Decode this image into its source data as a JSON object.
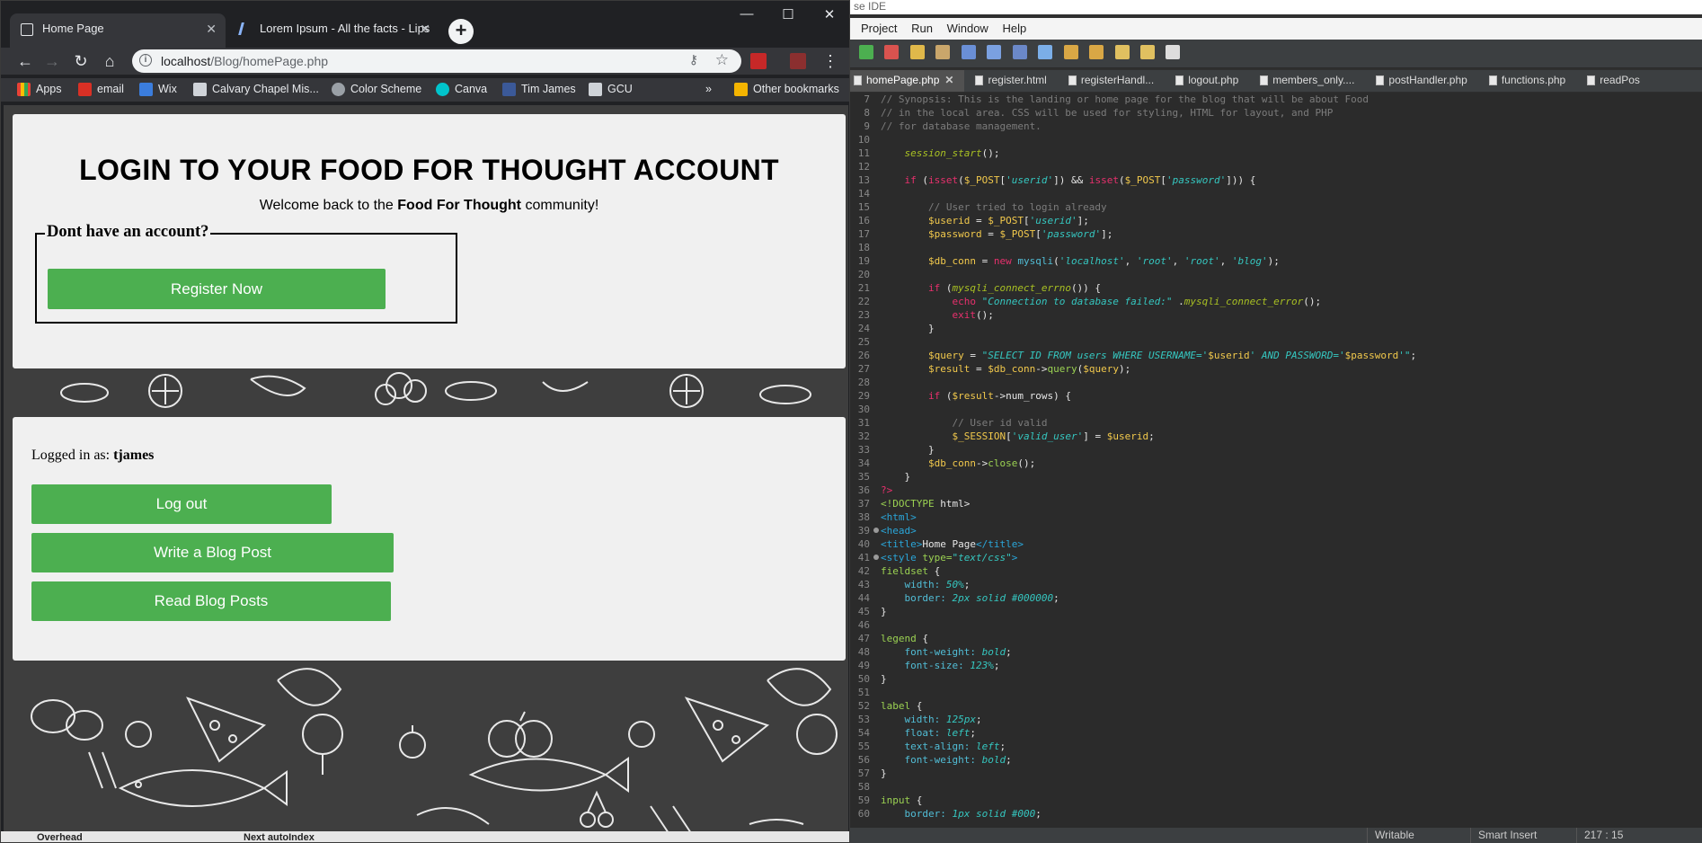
{
  "ide": {
    "title_fragment": "se IDE",
    "menu": [
      "Project",
      "Run",
      "Window",
      "Help"
    ],
    "tabs": [
      {
        "label": "homePage.php",
        "active": true
      },
      {
        "label": "register.html",
        "active": false
      },
      {
        "label": "registerHandl...",
        "active": false
      },
      {
        "label": "logout.php",
        "active": false
      },
      {
        "label": "members_only....",
        "active": false
      },
      {
        "label": "postHandler.php",
        "active": false
      },
      {
        "label": "functions.php",
        "active": false
      },
      {
        "label": "readPos",
        "active": false
      }
    ],
    "code": [
      {
        "n": "7",
        "segs": [
          [
            "c-comment",
            "// Synopsis: This is the landing or home page for the blog that will be about Food"
          ]
        ]
      },
      {
        "n": "8",
        "segs": [
          [
            "c-comment",
            "// in the local area. CSS will be used for styling, HTML for layout, and PHP"
          ]
        ]
      },
      {
        "n": "9",
        "segs": [
          [
            "c-comment",
            "// for database management."
          ]
        ]
      },
      {
        "n": "10",
        "segs": []
      },
      {
        "n": "11",
        "segs": [
          [
            "",
            "    "
          ],
          [
            "c-fn",
            "session_start"
          ],
          [
            "",
            "();"
          ]
        ]
      },
      {
        "n": "12",
        "segs": []
      },
      {
        "n": "13",
        "segs": [
          [
            "",
            "    "
          ],
          [
            "c-kw",
            "if"
          ],
          [
            "",
            " ("
          ],
          [
            "c-kw",
            "isset"
          ],
          [
            "",
            "("
          ],
          [
            "c-var",
            "$_POST"
          ],
          [
            "",
            "["
          ],
          [
            "c-str",
            "'userid'"
          ],
          [
            "",
            "]) && "
          ],
          [
            "c-kw",
            "isset"
          ],
          [
            "",
            "("
          ],
          [
            "c-var",
            "$_POST"
          ],
          [
            "",
            "["
          ],
          [
            "c-str",
            "'password'"
          ],
          [
            "",
            "])) {"
          ]
        ]
      },
      {
        "n": "14",
        "segs": []
      },
      {
        "n": "15",
        "segs": [
          [
            "",
            "        "
          ],
          [
            "c-comment",
            "// User tried to login already"
          ]
        ]
      },
      {
        "n": "16",
        "segs": [
          [
            "",
            "        "
          ],
          [
            "c-var",
            "$userid"
          ],
          [
            "",
            " = "
          ],
          [
            "c-var",
            "$_POST"
          ],
          [
            "",
            "["
          ],
          [
            "c-str",
            "'userid'"
          ],
          [
            "",
            "];"
          ]
        ]
      },
      {
        "n": "17",
        "segs": [
          [
            "",
            "        "
          ],
          [
            "c-var",
            "$password"
          ],
          [
            "",
            " = "
          ],
          [
            "c-var",
            "$_POST"
          ],
          [
            "",
            "["
          ],
          [
            "c-str",
            "'password'"
          ],
          [
            "",
            "];"
          ]
        ]
      },
      {
        "n": "18",
        "segs": []
      },
      {
        "n": "19",
        "segs": [
          [
            "",
            "        "
          ],
          [
            "c-var",
            "$db_conn"
          ],
          [
            "",
            " = "
          ],
          [
            "c-kw",
            "new"
          ],
          [
            "",
            " "
          ],
          [
            "c-prop",
            "mysqli"
          ],
          [
            "",
            "("
          ],
          [
            "c-str",
            "'localhost'"
          ],
          [
            "",
            ", "
          ],
          [
            "c-str",
            "'root'"
          ],
          [
            "",
            ", "
          ],
          [
            "c-str",
            "'root'"
          ],
          [
            "",
            ", "
          ],
          [
            "c-str",
            "'blog'"
          ],
          [
            "",
            ");"
          ]
        ]
      },
      {
        "n": "20",
        "segs": []
      },
      {
        "n": "21",
        "segs": [
          [
            "",
            "        "
          ],
          [
            "c-kw",
            "if"
          ],
          [
            "",
            " ("
          ],
          [
            "c-fn",
            "mysqli_connect_errno"
          ],
          [
            "",
            "()) {"
          ]
        ]
      },
      {
        "n": "22",
        "segs": [
          [
            "",
            "            "
          ],
          [
            "c-kw",
            "echo"
          ],
          [
            "",
            " "
          ],
          [
            "c-str",
            "\"Connection to database failed:\""
          ],
          [
            "",
            " ."
          ],
          [
            "c-fn",
            "mysqli_connect_error"
          ],
          [
            "",
            "();"
          ]
        ]
      },
      {
        "n": "23",
        "segs": [
          [
            "",
            "            "
          ],
          [
            "c-kw",
            "exit"
          ],
          [
            "",
            "();"
          ]
        ]
      },
      {
        "n": "24",
        "segs": [
          [
            "",
            "        }"
          ]
        ]
      },
      {
        "n": "25",
        "segs": []
      },
      {
        "n": "26",
        "segs": [
          [
            "",
            "        "
          ],
          [
            "c-var",
            "$query"
          ],
          [
            "",
            " = "
          ],
          [
            "c-str",
            "\"SELECT ID FROM users WHERE USERNAME='"
          ],
          [
            "c-var",
            "$userid"
          ],
          [
            "c-str",
            "' AND PASSWORD='"
          ],
          [
            "c-var",
            "$password"
          ],
          [
            "c-str",
            "'\""
          ],
          [
            "",
            ";"
          ]
        ]
      },
      {
        "n": "27",
        "segs": [
          [
            "",
            "        "
          ],
          [
            "c-var",
            "$result"
          ],
          [
            "",
            " = "
          ],
          [
            "c-var",
            "$db_conn"
          ],
          [
            "",
            "->"
          ],
          [
            "c-sel",
            "query"
          ],
          [
            "",
            "("
          ],
          [
            "c-var",
            "$query"
          ],
          [
            "",
            ");"
          ]
        ]
      },
      {
        "n": "28",
        "segs": []
      },
      {
        "n": "29",
        "segs": [
          [
            "",
            "        "
          ],
          [
            "c-kw",
            "if"
          ],
          [
            "",
            " ("
          ],
          [
            "c-var",
            "$result"
          ],
          [
            "",
            "->"
          ],
          [
            "",
            "num_rows"
          ],
          [
            "",
            ") {"
          ]
        ]
      },
      {
        "n": "30",
        "segs": []
      },
      {
        "n": "31",
        "segs": [
          [
            "",
            "            "
          ],
          [
            "c-comment",
            "// User id valid"
          ]
        ]
      },
      {
        "n": "32",
        "segs": [
          [
            "",
            "            "
          ],
          [
            "c-var",
            "$_SESSION"
          ],
          [
            "",
            "["
          ],
          [
            "c-str",
            "'valid_user'"
          ],
          [
            "",
            "] = "
          ],
          [
            "c-var",
            "$userid"
          ],
          [
            "",
            ";"
          ]
        ]
      },
      {
        "n": "33",
        "segs": [
          [
            "",
            "        }"
          ]
        ]
      },
      {
        "n": "34",
        "segs": [
          [
            "",
            "        "
          ],
          [
            "c-var",
            "$db_conn"
          ],
          [
            "",
            "->"
          ],
          [
            "c-sel",
            "close"
          ],
          [
            "",
            "();"
          ]
        ]
      },
      {
        "n": "35",
        "segs": [
          [
            "",
            "    }"
          ]
        ]
      },
      {
        "n": "36",
        "segs": [
          [
            "c-kw",
            "?>"
          ]
        ]
      },
      {
        "n": "37",
        "segs": [
          [
            "c-sel",
            "<!DOCTYPE"
          ],
          [
            "",
            " html>"
          ]
        ]
      },
      {
        "n": "38",
        "segs": [
          [
            "c-tag",
            "<html>"
          ]
        ]
      },
      {
        "n": "39",
        "fold": true,
        "segs": [
          [
            "c-tag",
            "<head>"
          ]
        ]
      },
      {
        "n": "40",
        "segs": [
          [
            "c-tag",
            "<title>"
          ],
          [
            "",
            "Home Page"
          ],
          [
            "c-tag",
            "</title>"
          ]
        ]
      },
      {
        "n": "41",
        "fold": true,
        "segs": [
          [
            "c-tag",
            "<style"
          ],
          [
            "c-sel",
            " type="
          ],
          [
            "c-str",
            "\"text/css\""
          ],
          [
            "c-tag",
            ">"
          ]
        ]
      },
      {
        "n": "42",
        "segs": [
          [
            "c-sel",
            "fieldset"
          ],
          [
            "",
            " {"
          ]
        ]
      },
      {
        "n": "43",
        "segs": [
          [
            "",
            "    "
          ],
          [
            "c-prop",
            "width:"
          ],
          [
            "",
            " "
          ],
          [
            "c-str",
            "50%"
          ],
          [
            "",
            ";"
          ]
        ]
      },
      {
        "n": "44",
        "segs": [
          [
            "",
            "    "
          ],
          [
            "c-prop",
            "border:"
          ],
          [
            "",
            " "
          ],
          [
            "c-str",
            "2px solid #000000"
          ],
          [
            "",
            ";"
          ]
        ]
      },
      {
        "n": "45",
        "segs": [
          [
            "",
            "}"
          ]
        ]
      },
      {
        "n": "46",
        "segs": []
      },
      {
        "n": "47",
        "segs": [
          [
            "c-sel",
            "legend"
          ],
          [
            "",
            " {"
          ]
        ]
      },
      {
        "n": "48",
        "segs": [
          [
            "",
            "    "
          ],
          [
            "c-prop",
            "font-weight:"
          ],
          [
            "",
            " "
          ],
          [
            "c-str",
            "bold"
          ],
          [
            "",
            ";"
          ]
        ]
      },
      {
        "n": "49",
        "segs": [
          [
            "",
            "    "
          ],
          [
            "c-prop",
            "font-size:"
          ],
          [
            "",
            " "
          ],
          [
            "c-str",
            "123%"
          ],
          [
            "",
            ";"
          ]
        ]
      },
      {
        "n": "50",
        "segs": [
          [
            "",
            "}"
          ]
        ]
      },
      {
        "n": "51",
        "segs": []
      },
      {
        "n": "52",
        "segs": [
          [
            "c-sel",
            "label"
          ],
          [
            "",
            " {"
          ]
        ]
      },
      {
        "n": "53",
        "segs": [
          [
            "",
            "    "
          ],
          [
            "c-prop",
            "width:"
          ],
          [
            "",
            " "
          ],
          [
            "c-str",
            "125px"
          ],
          [
            "",
            ";"
          ]
        ]
      },
      {
        "n": "54",
        "segs": [
          [
            "",
            "    "
          ],
          [
            "c-prop",
            "float:"
          ],
          [
            "",
            " "
          ],
          [
            "c-str",
            "left"
          ],
          [
            "",
            ";"
          ]
        ]
      },
      {
        "n": "55",
        "segs": [
          [
            "",
            "    "
          ],
          [
            "c-prop",
            "text-align:"
          ],
          [
            "",
            " "
          ],
          [
            "c-str",
            "left"
          ],
          [
            "",
            ";"
          ]
        ]
      },
      {
        "n": "56",
        "segs": [
          [
            "",
            "    "
          ],
          [
            "c-prop",
            "font-weight:"
          ],
          [
            "",
            " "
          ],
          [
            "c-str",
            "bold"
          ],
          [
            "",
            ";"
          ]
        ]
      },
      {
        "n": "57",
        "segs": [
          [
            "",
            "}"
          ]
        ]
      },
      {
        "n": "58",
        "segs": []
      },
      {
        "n": "59",
        "segs": [
          [
            "c-sel",
            "input"
          ],
          [
            "",
            " {"
          ]
        ]
      },
      {
        "n": "60",
        "segs": [
          [
            "",
            "    "
          ],
          [
            "c-prop",
            "border:"
          ],
          [
            "",
            " "
          ],
          [
            "c-str",
            "1px solid #000"
          ],
          [
            "",
            ";"
          ]
        ]
      }
    ],
    "status": {
      "mode": "Writable",
      "insert": "Smart Insert",
      "position": "217 : 15"
    }
  },
  "browser": {
    "tabs": [
      {
        "title": "Home Page",
        "active": true
      },
      {
        "title": "Lorem Ipsum - All the facts - Lips",
        "active": false
      }
    ],
    "url_host": "localhost",
    "url_path": "/Blog/homePage.php",
    "bookmarks": [
      "Apps",
      "email",
      "Wix",
      "Calvary Chapel Mis...",
      "Color Scheme",
      "Canva",
      "Tim James",
      "GCU"
    ],
    "other_bookmarks": "Other bookmarks",
    "overflow": "»"
  },
  "page": {
    "login_title": "LOGIN TO YOUR FOOD FOR THOUGHT ACCOUNT",
    "welcome_pre": "Welcome back to the ",
    "welcome_bold": "Food For Thought",
    "welcome_post": " community!",
    "legend": "Dont have an account?",
    "register_label": "Register Now",
    "logged_in_prefix": "Logged in as: ",
    "username": "tjames",
    "logout_label": "Log out",
    "write_label": "Write a Blog Post",
    "read_label": "Read Blog Posts"
  },
  "taskbar": {
    "left_text": "Overhead",
    "right_text": "Next autoIndex"
  },
  "colors": {
    "accent": "#4caf50",
    "panel": "#f0f0f0",
    "ide_bg": "#2b2b2b"
  }
}
